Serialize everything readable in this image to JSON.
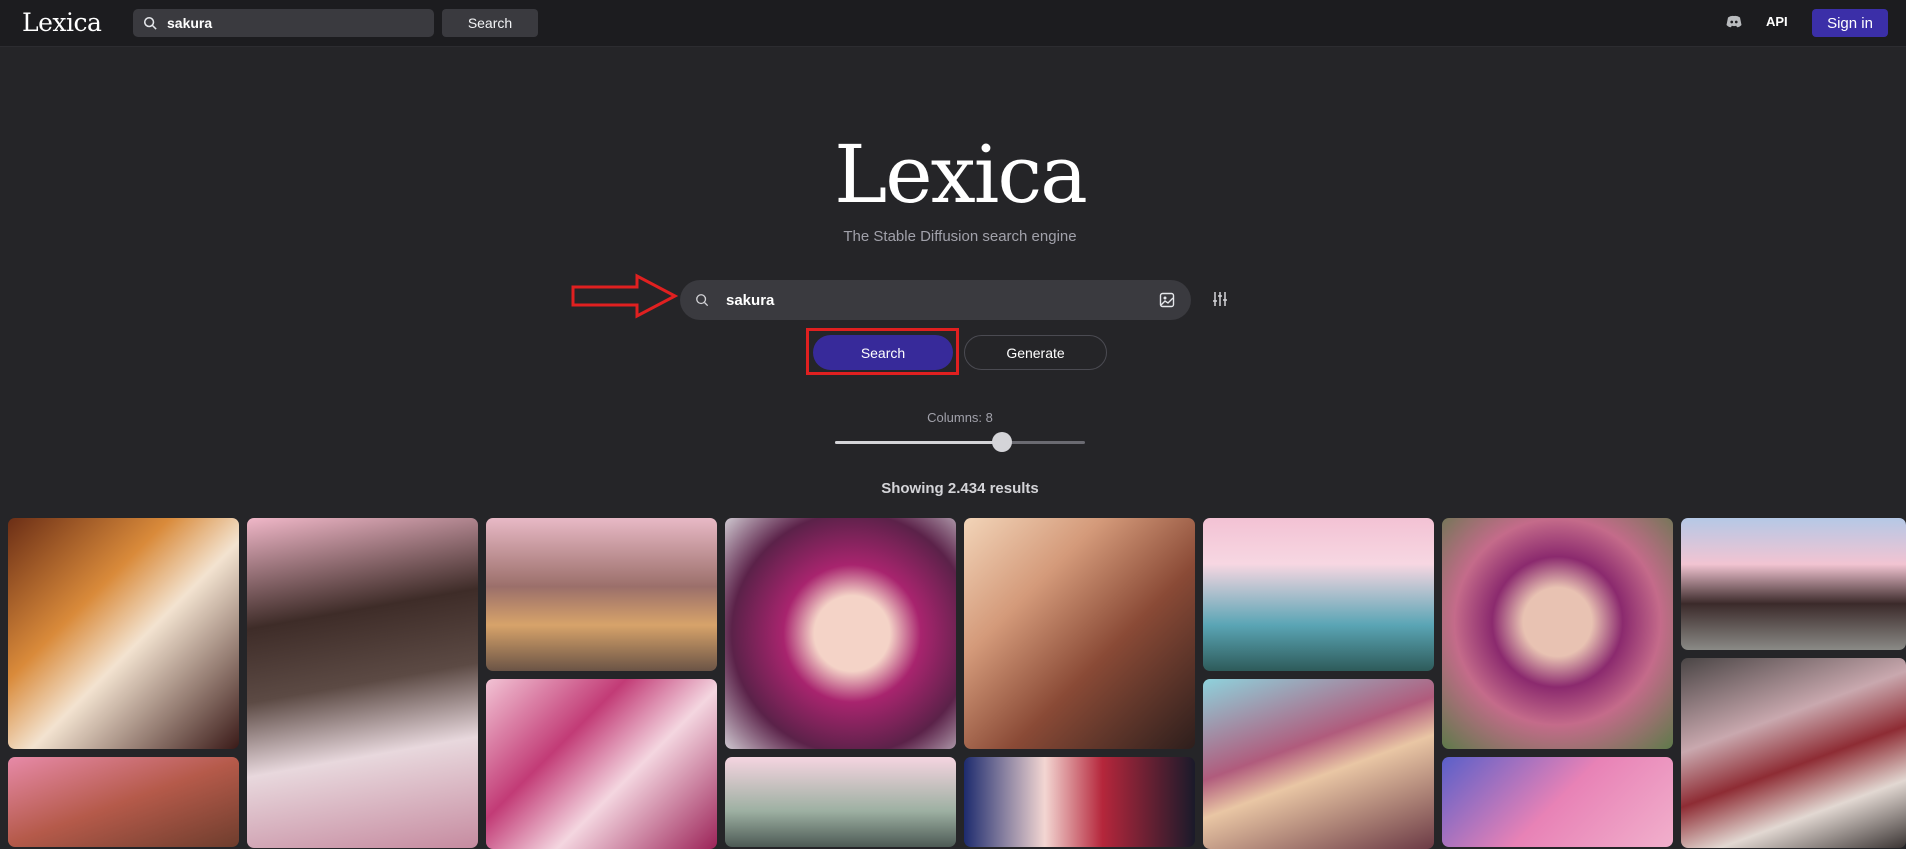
{
  "topbar": {
    "logo": "Lexica",
    "search_value": "sakura",
    "search_button": "Search",
    "discord_icon": "discord-icon",
    "api_label": "API",
    "signin_label": "Sign in"
  },
  "hero": {
    "title": "Lexica",
    "subtitle": "The Stable Diffusion search engine"
  },
  "search": {
    "value": "sakura",
    "search_button": "Search",
    "generate_button": "Generate"
  },
  "columns": {
    "label": "Columns: 8",
    "value": 8,
    "min": 2,
    "max": 11
  },
  "results_text": "Showing 2.434 results",
  "gallery": [
    "anime-girl-dark-hair-window",
    "anime-girl-kimono-cherry-blossom",
    "cherry-blossom-temple-lake",
    "sakura-headband-portrait",
    "pink-hair-girl-kimono",
    "cherry-blossom-river",
    "purple-hair-woman-pink-outfit",
    "japanese-street-cherry-blossom",
    "anime-girl-brown-hair-blossom",
    "pink-hair-girls-collage",
    "cherry-blossom-garden",
    "red-hair-anime-girl",
    "fox-ear-anime-girl",
    "pink-hair-anime-boy",
    "two-kimono-girls-ink"
  ],
  "colors": {
    "accent": "#372a9a",
    "highlight": "#e02020",
    "background": "#252528"
  }
}
